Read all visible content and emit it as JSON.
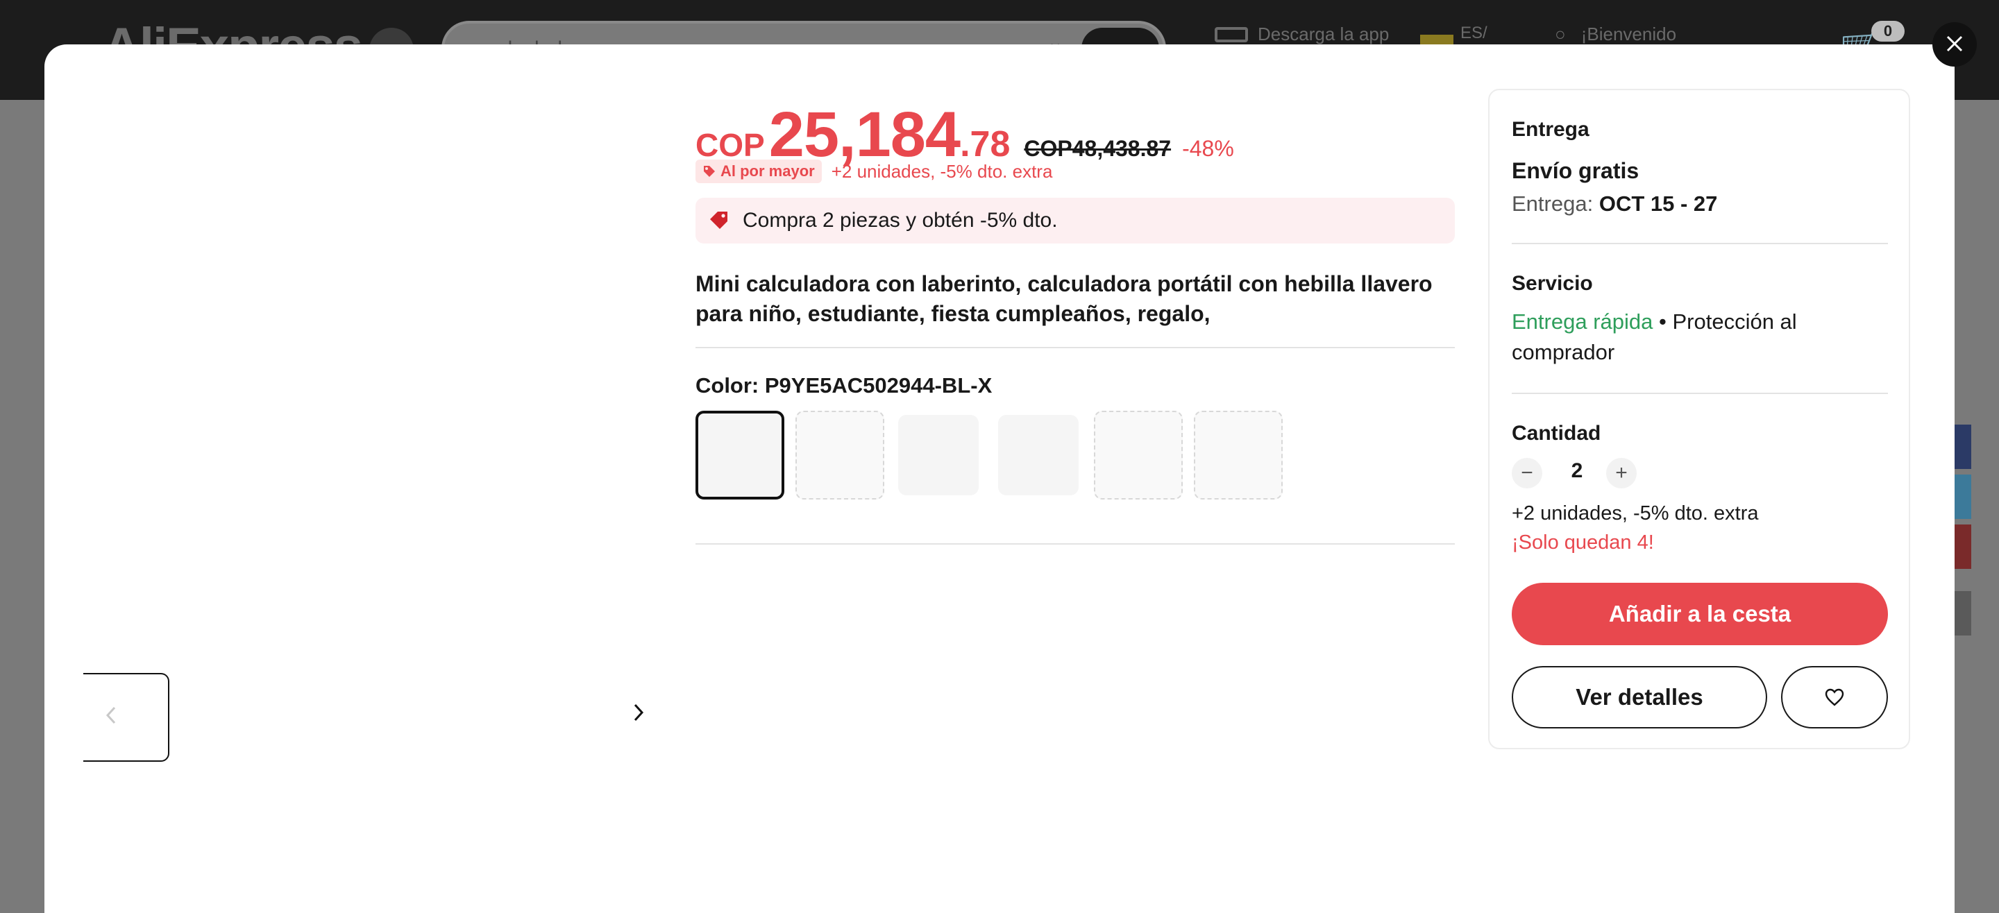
{
  "background": {
    "logo": "AliExpress",
    "search_text": "calculadora",
    "app_download": "Descarga la app",
    "language": "ES/",
    "welcome": "¡Bienvenido",
    "cart_count": "0"
  },
  "modal": {
    "close_icon": "close-icon",
    "gallery": {
      "prev_icon": "chevron-left-icon",
      "next_icon": "chevron-right-icon"
    },
    "price": {
      "currency": "COP",
      "integer": "25,184",
      "decimal": ".78",
      "original": "COP48,438.87",
      "discount": "-48%"
    },
    "bulk": {
      "badge": "Al por mayor",
      "extra": "+2 unidades, -5% dto. extra"
    },
    "promo": {
      "icon": "tag-icon",
      "text": "Compra 2 piezas y obtén -5% dto."
    },
    "title": "Mini calculadora con laberinto, calculadora portátil con hebilla llavero para niño, estudiante, fiesta cumpleaños, regalo,",
    "color": {
      "label": "Color: P9YE5AC502944-BL-X",
      "swatches": [
        {
          "state": "selected"
        },
        {
          "state": "unavailable"
        },
        {
          "state": "available"
        },
        {
          "state": "available"
        },
        {
          "state": "unavailable"
        },
        {
          "state": "unavailable"
        }
      ]
    },
    "panel": {
      "delivery_heading": "Entrega",
      "shipping": "Envío gratis",
      "delivery_label": "Entrega:",
      "delivery_dates": "OCT 15 - 27",
      "service_heading": "Servicio",
      "service_fast": "Entrega rápida",
      "service_sep": " • ",
      "service_protection": "Protección al comprador",
      "quantity_heading": "Cantidad",
      "quantity": "2",
      "minus_icon": "minus-icon",
      "plus_icon": "plus-icon",
      "quantity_extra": "+2 unidades, -5% dto. extra",
      "stock": "¡Solo quedan 4!",
      "add_to_cart": "Añadir a la cesta",
      "view_details": "Ver detalles",
      "wishlist_icon": "heart-icon"
    },
    "colors": {
      "accent": "#e8484e",
      "green": "#2e9e5b"
    }
  }
}
